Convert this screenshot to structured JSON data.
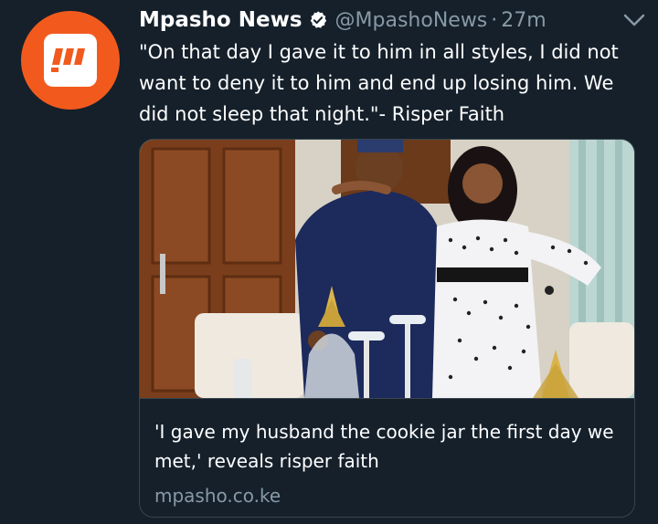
{
  "tweet": {
    "author_name": "Mpasho News",
    "handle": "@MpashoNews",
    "separator": "·",
    "time": "27m",
    "text": "\"On that day I gave it to him in all styles, I did not want to deny it to him and end up losing him. We did not sleep that night.\"- Risper Faith",
    "icons": {
      "verified": "verified-badge-icon",
      "caret": "chevron-down-icon",
      "avatar": "mpasho-logo"
    },
    "avatar_logo_text": "!!!"
  },
  "card": {
    "title": "'I gave my husband the cookie jar the first day we met,' reveals risper faith",
    "domain": "mpasho.co.ke"
  },
  "colors": {
    "background": "#15202b",
    "avatar": "#f25a1d",
    "secondary_text": "#8899a6",
    "border": "#38444d",
    "verified": "#ffffff"
  }
}
